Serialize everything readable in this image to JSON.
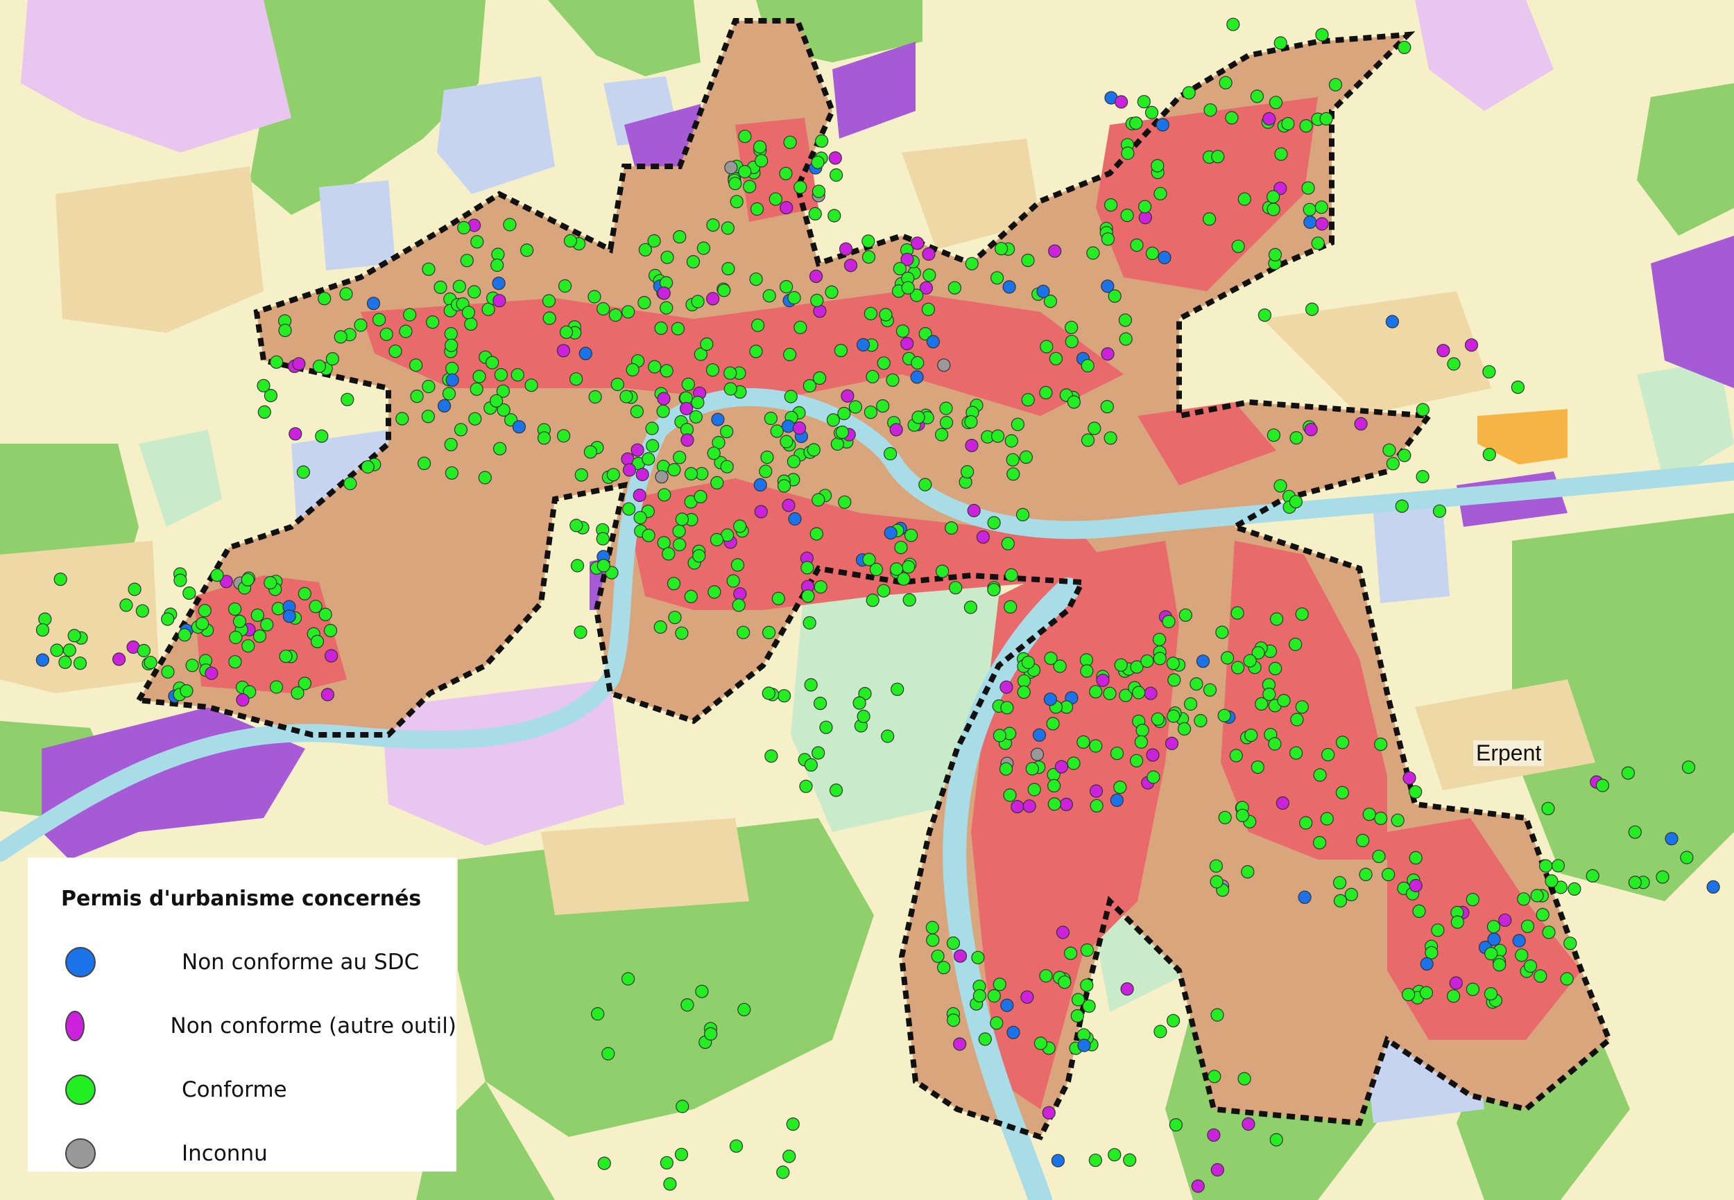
{
  "map": {
    "place_label": "Erpent",
    "colors": {
      "agricultural": "#f5f0c8",
      "forest": "#8fcf6c",
      "green_space": "#c9ebc9",
      "residential": "#eed9a6",
      "core_urban": "#e86a6a",
      "perimeter_fill": "#d9a57d",
      "public_services": "#c7d4f0",
      "industrial": "#a65ad6",
      "industrial_light": "#e8c6ef",
      "river": "#a8dde8",
      "recreation": "#f5b444",
      "perimeter_line": "#111111"
    }
  },
  "legend": {
    "title": "Permis d'urbanisme concernés",
    "items": [
      {
        "label": "Non conforme au SDC",
        "color": "#1a73e8"
      },
      {
        "label": "Non conforme (autre outil)",
        "color": "#cc22dd"
      },
      {
        "label": "Conforme",
        "color": "#22ee22"
      },
      {
        "label": "Inconnu",
        "color": "#999999"
      }
    ]
  }
}
